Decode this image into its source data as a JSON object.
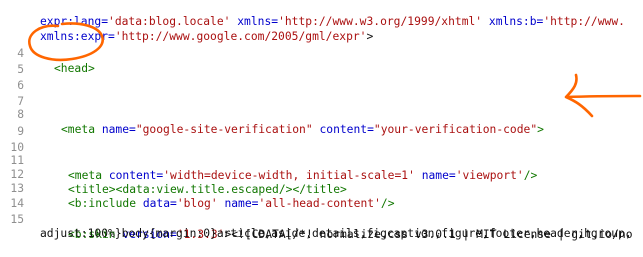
{
  "editor": {
    "line_numbers": [
      "4",
      "5",
      "6",
      "7",
      "8",
      "9",
      "10",
      "11",
      "12",
      "13",
      "14",
      "15"
    ],
    "top_wrap_1": {
      "a1": "expr:lang=",
      "s1": "'data:blog.locale'",
      "a2": " xmlns=",
      "s2": "'http://www.w3.org/1999/xhtml'",
      "a3": " xmlns:b=",
      "s3": "'http://www."
    },
    "top_wrap_2": {
      "a1": "xmlns:expr=",
      "s1": "'http://www.google.com/2005/gml/expr'",
      "p1": ">"
    },
    "line4": {
      "tag": "<head>"
    },
    "line8": {
      "open": "<meta",
      "a1": " name=",
      "s1": "\"google-site-verification\"",
      "a2": " content=",
      "s2": "\"your-verification-code\"",
      "close": ">"
    },
    "line11": {
      "open": "<meta",
      "a1": " content=",
      "s1": "'width=device-width, initial-scale=1'",
      "a2": " name=",
      "s2": "'viewport'",
      "close": "/>"
    },
    "line12": {
      "open": "<title>",
      "mid": "<data:view.title.escaped/>",
      "close": "</title>"
    },
    "line13": {
      "open": "<b:include",
      "a1": " data=",
      "s1": "'blog'",
      "a2": " name=",
      "s2": "'all-head-content'",
      "close": "/>"
    },
    "line15": {
      "open": "<b:skin",
      "a1": " version=",
      "s1": "'1.3.3'",
      "p1": "><![CDATA[/*! normalize.css v3.0.1 | MIT License | git.io/no"
    },
    "wrap_after_15": {
      "text": "adjust:100%}body{margin:0}article,aside,details,figcaption,figure,footer,header,hgroup,"
    }
  },
  "annotations": {
    "color": "#ff6600"
  }
}
